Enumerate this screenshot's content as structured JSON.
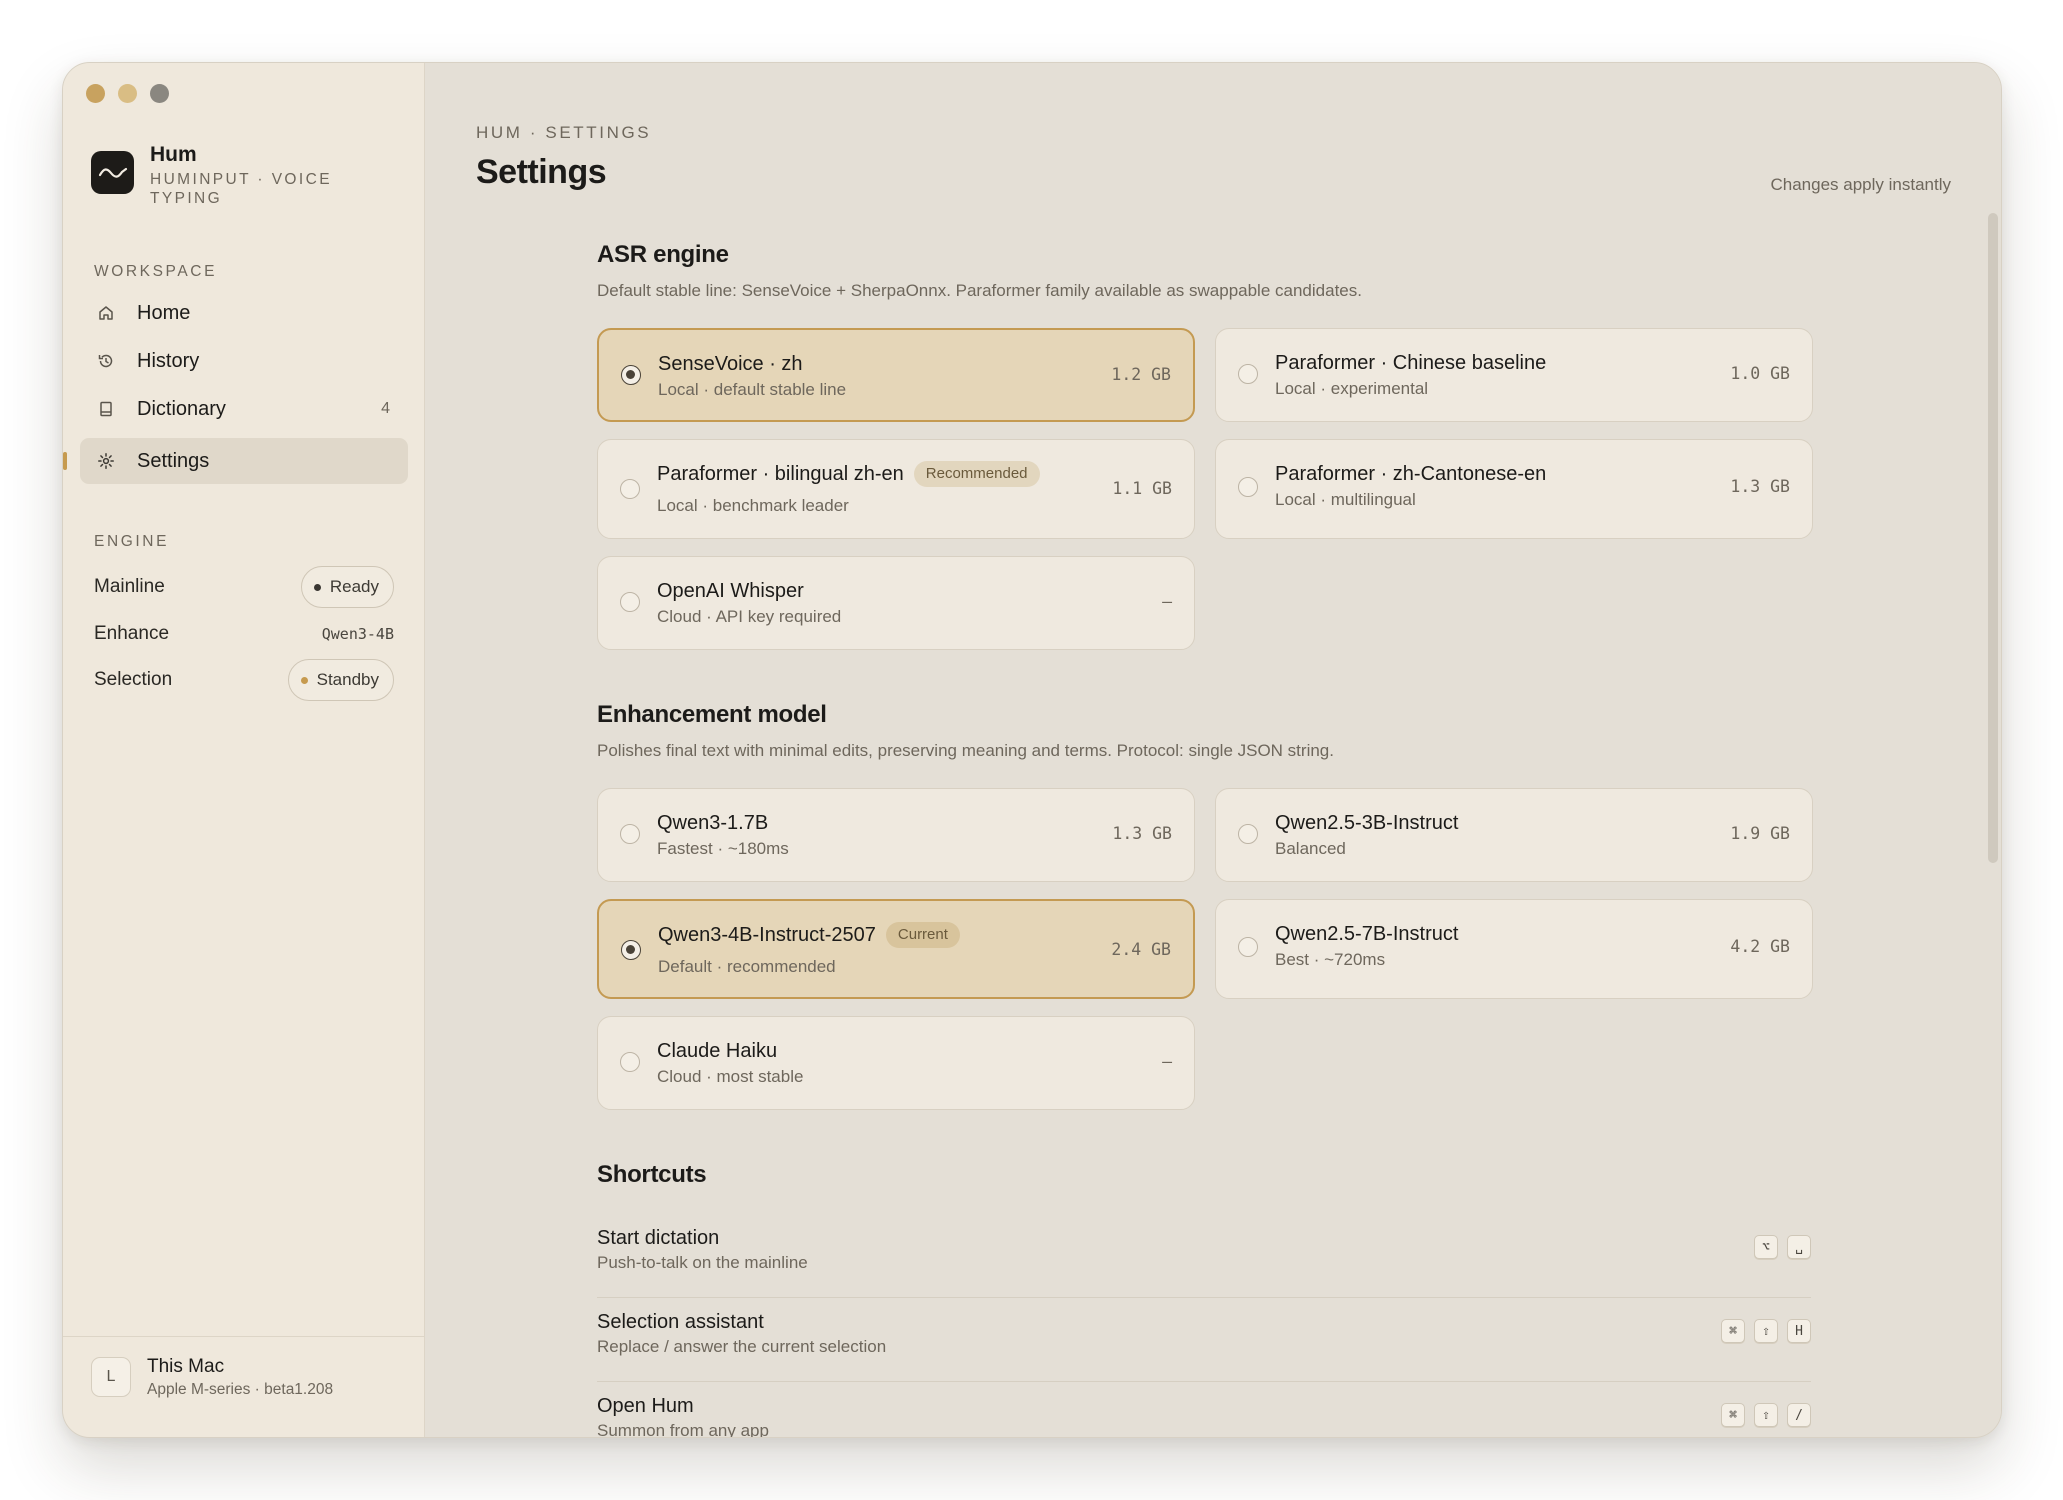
{
  "app": {
    "name": "Hum",
    "subtitle": "HUMINPUT · VOICE TYPING"
  },
  "sidebar": {
    "workspace_label": "WORKSPACE",
    "nav": [
      {
        "label": "Home",
        "icon": "home-icon"
      },
      {
        "label": "History",
        "icon": "history-icon"
      },
      {
        "label": "Dictionary",
        "icon": "dictionary-icon",
        "count": "4"
      },
      {
        "label": "Settings",
        "icon": "gear-icon",
        "active": true
      }
    ],
    "engine_label": "ENGINE",
    "engine": {
      "mainline": {
        "label": "Mainline",
        "status": "Ready",
        "dot_color": "#3a3732"
      },
      "enhance": {
        "label": "Enhance",
        "value": "Qwen3-4B"
      },
      "selection": {
        "label": "Selection",
        "status": "Standby",
        "dot_color": "#c69a4e"
      }
    },
    "footer": {
      "avatar": "L",
      "name": "This Mac",
      "sub": "Apple M-series · beta1.208"
    }
  },
  "main": {
    "breadcrumb": "HUM · SETTINGS",
    "title": "Settings",
    "apply_note": "Changes apply instantly",
    "asr": {
      "title": "ASR engine",
      "desc": "Default stable line: SenseVoice + SherpaOnnx. Paraformer family available as swappable candidates.",
      "options": [
        {
          "name": "SenseVoice · zh",
          "sub": "Local · default stable line",
          "size": "1.2 GB",
          "selected": true
        },
        {
          "name": "Paraformer · Chinese baseline",
          "sub": "Local · experimental",
          "size": "1.0 GB"
        },
        {
          "name": "Paraformer · bilingual zh-en",
          "tag": "Recommended",
          "sub": "Local · benchmark leader",
          "size": "1.1 GB"
        },
        {
          "name": "Paraformer · zh-Cantonese-en",
          "sub": "Local · multilingual",
          "size": "1.3 GB"
        },
        {
          "name": "OpenAI Whisper",
          "sub": "Cloud · API key required",
          "size": "–"
        }
      ]
    },
    "enhancement": {
      "title": "Enhancement model",
      "desc": "Polishes final text with minimal edits, preserving meaning and terms. Protocol: single JSON string.",
      "options": [
        {
          "name": "Qwen3-1.7B",
          "sub": "Fastest · ~180ms",
          "size": "1.3 GB"
        },
        {
          "name": "Qwen2.5-3B-Instruct",
          "sub": "Balanced",
          "size": "1.9 GB"
        },
        {
          "name": "Qwen3-4B-Instruct-2507",
          "tag": "Current",
          "sub": "Default · recommended",
          "size": "2.4 GB",
          "selected": true
        },
        {
          "name": "Qwen2.5-7B-Instruct",
          "sub": "Best · ~720ms",
          "size": "4.2 GB"
        },
        {
          "name": "Claude Haiku",
          "sub": "Cloud · most stable",
          "size": "–"
        }
      ]
    },
    "shortcuts": {
      "title": "Shortcuts",
      "items": [
        {
          "name": "Start dictation",
          "sub": "Push-to-talk on the mainline",
          "keys": [
            "⌥",
            "␣"
          ]
        },
        {
          "name": "Selection assistant",
          "sub": "Replace / answer the current selection",
          "keys": [
            "⌘",
            "⇧",
            "H"
          ]
        },
        {
          "name": "Open Hum",
          "sub": "Summon from any app",
          "keys": [
            "⌘",
            "⇧",
            "/"
          ]
        }
      ]
    }
  },
  "colors": {
    "accent": "#c69a4e",
    "selected_card_bg": "#e5d6b8",
    "sidebar_bg": "#efe8dc",
    "main_bg": "#e4dfd6"
  }
}
